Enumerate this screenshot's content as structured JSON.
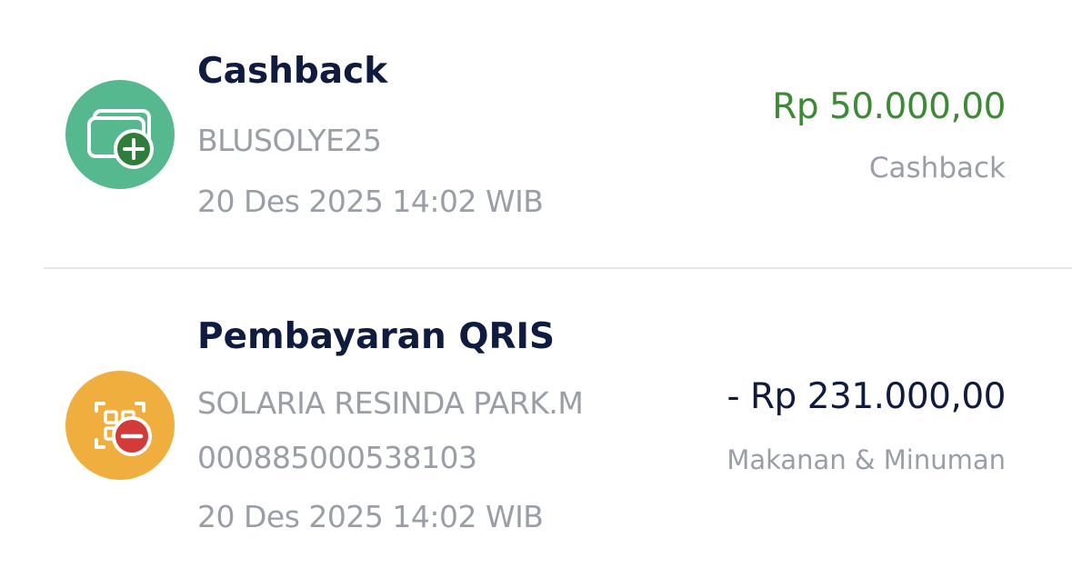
{
  "colors": {
    "cashback_icon_bg": "#55b88f",
    "cashback_badge": "#2f7d3b",
    "qris_icon_bg": "#f0ae3f",
    "qris_badge": "#d33b3b",
    "credit_amount": "#3d8a34",
    "debit_amount": "#0f1c3f"
  },
  "transactions": [
    {
      "icon": "wallet-plus-icon",
      "title": "Cashback",
      "details": [
        "BLUSOLYE25",
        "20 Des 2025 14:02 WIB"
      ],
      "amount": "Rp 50.000,00",
      "category": "Cashback"
    },
    {
      "icon": "qr-scan-minus-icon",
      "title": "Pembayaran QRIS",
      "details": [
        "SOLARIA RESINDA PARK.M",
        "000885000538103",
        "20 Des 2025 14:02 WIB"
      ],
      "amount": "- Rp 231.000,00",
      "category": "Makanan & Minuman"
    }
  ]
}
